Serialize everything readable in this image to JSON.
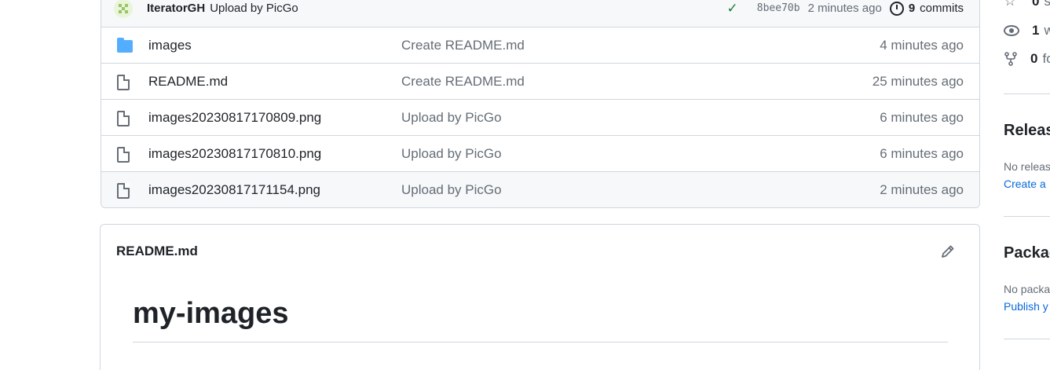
{
  "commit_bar": {
    "author": "IteratorGH",
    "message": "Upload by PicGo",
    "sha": "8bee70b",
    "time": "2 minutes ago",
    "commits_count": "9",
    "commits_label": "commits"
  },
  "files": [
    {
      "name": "images",
      "type": "folder",
      "message": "Create README.md",
      "time": "4 minutes ago"
    },
    {
      "name": "README.md",
      "type": "file",
      "message": "Create README.md",
      "time": "25 minutes ago"
    },
    {
      "name": "images20230817170809.png",
      "type": "file",
      "message": "Upload by PicGo",
      "time": "6 minutes ago"
    },
    {
      "name": "images20230817170810.png",
      "type": "file",
      "message": "Upload by PicGo",
      "time": "6 minutes ago"
    },
    {
      "name": "images20230817171154.png",
      "type": "file",
      "message": "Upload by PicGo",
      "time": "2 minutes ago"
    }
  ],
  "readme": {
    "filename": "README.md",
    "heading": "my-images"
  },
  "sidebar": {
    "stars": {
      "count": "0",
      "label": "s"
    },
    "watching": {
      "count": "1",
      "label": "w"
    },
    "forks": {
      "count": "0",
      "label": "fo"
    },
    "releases": {
      "title": "Releas",
      "text": "No releas",
      "link": "Create a"
    },
    "packages": {
      "title": "Packag",
      "text": "No packa",
      "link": "Publish y"
    }
  },
  "colors": {
    "accent": "#0969da",
    "folder": "#54aeff",
    "success": "#1a7f37",
    "border": "#d0d7de",
    "muted": "#656d76"
  }
}
